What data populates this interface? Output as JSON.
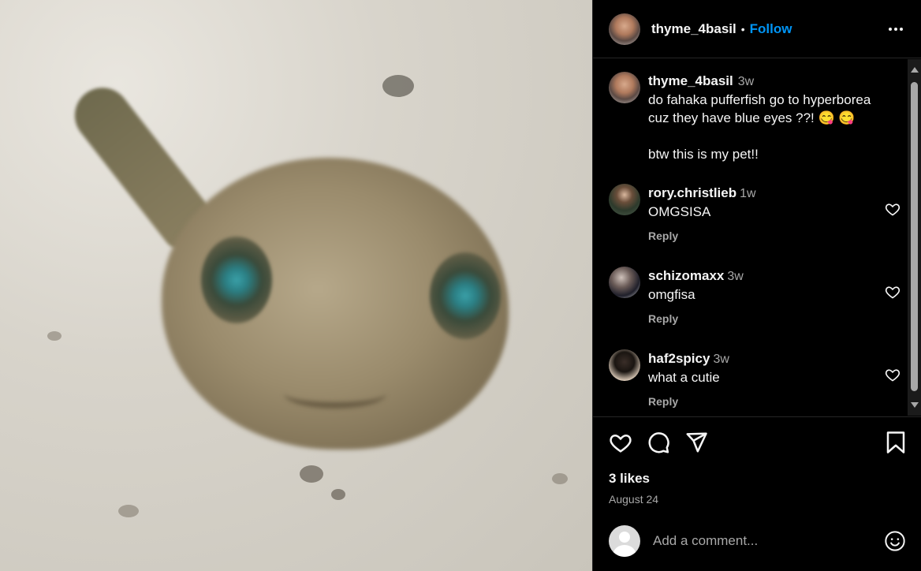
{
  "post": {
    "image_alt": "Blurry photo of a fahaka pufferfish with blue eyes",
    "author": {
      "username": "thyme_4basil",
      "follow_label": "Follow",
      "separator": "•"
    },
    "caption": {
      "username": "thyme_4basil",
      "time": "3w",
      "text": "do fahaka pufferfish go to hyperborea cuz they have blue eyes ??! 😋 😋\n\nbtw this is my pet!!"
    },
    "comments": [
      {
        "username": "rory.christlieb",
        "time": "1w",
        "text": "OMGSISA",
        "reply_label": "Reply"
      },
      {
        "username": "schizomaxx",
        "time": "3w",
        "text": "omgfisa",
        "reply_label": "Reply"
      },
      {
        "username": "haf2spicy",
        "time": "3w",
        "text": "what a cutie",
        "reply_label": "Reply"
      }
    ],
    "likes": "3 likes",
    "date": "August 24",
    "add_comment": {
      "placeholder": "Add a comment..."
    }
  },
  "icons": {
    "more": "more-options-icon",
    "like": "heart-icon",
    "comment": "comment-bubble-icon",
    "share": "paper-plane-icon",
    "save": "bookmark-icon",
    "emoji": "emoji-icon"
  },
  "colors": {
    "accent": "#0095f6",
    "background": "#000000",
    "muted": "#a8a8a8"
  }
}
